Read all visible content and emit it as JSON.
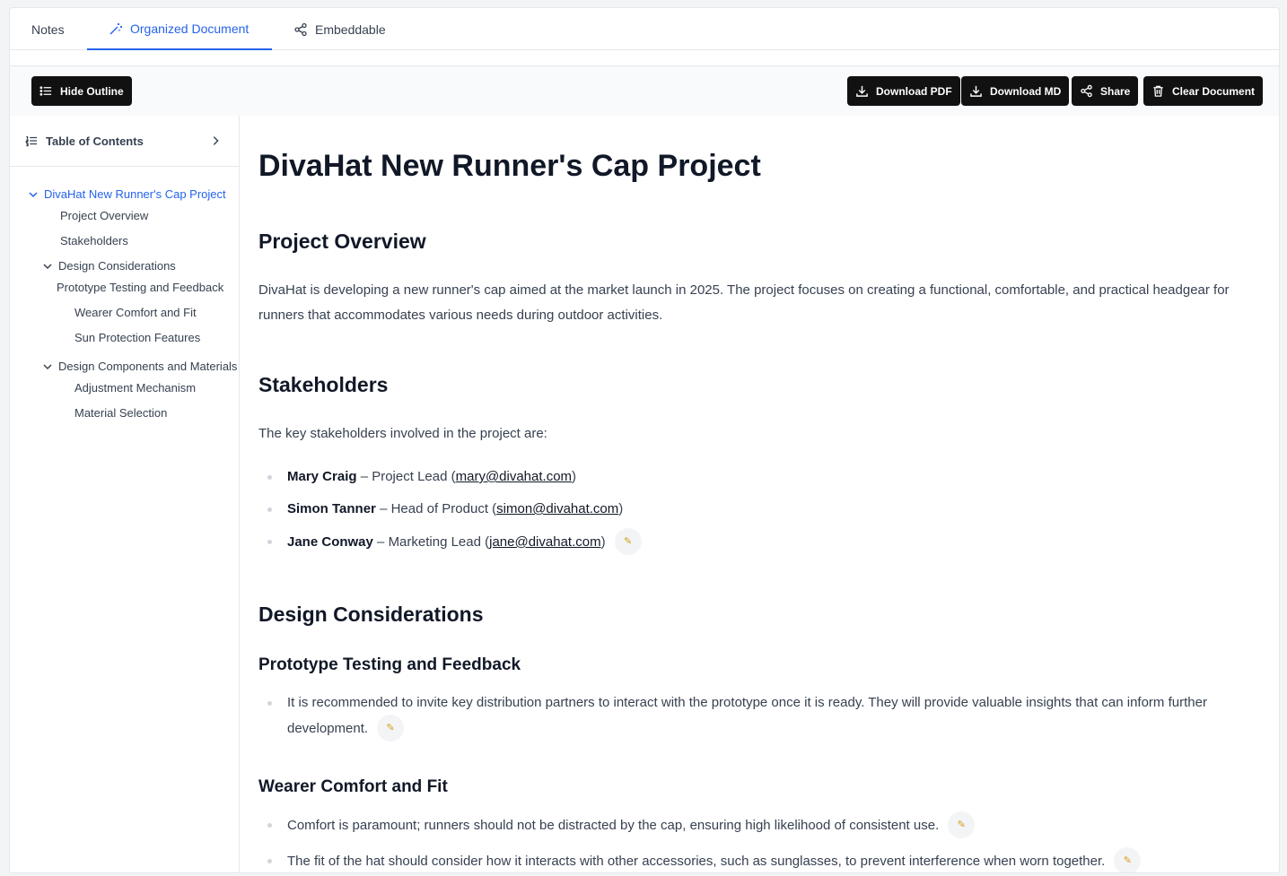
{
  "tabs": [
    {
      "label": "Notes",
      "icon": "none"
    },
    {
      "label": "Organized Document",
      "icon": "magic-wand-icon",
      "active": true
    },
    {
      "label": "Embeddable",
      "icon": "share-nodes-icon"
    }
  ],
  "toolbar": {
    "hide_outline": "Hide Outline",
    "download_pdf": "Download PDF",
    "download_md": "Download MD",
    "share": "Share",
    "clear_document": "Clear Document"
  },
  "toc": {
    "title": "Table of Contents",
    "items": [
      {
        "label": "DivaHat New Runner's Cap Project"
      },
      {
        "label": "Project Overview"
      },
      {
        "label": "Stakeholders"
      },
      {
        "label": "Design Considerations"
      },
      {
        "label": "Prototype Testing and Feedback"
      },
      {
        "label": "Wearer Comfort and Fit"
      },
      {
        "label": "Sun Protection Features"
      },
      {
        "label": "Design Components and Materials"
      },
      {
        "label": "Adjustment Mechanism"
      },
      {
        "label": "Material Selection"
      }
    ]
  },
  "doc": {
    "title": "DivaHat New Runner's Cap Project",
    "overview_heading": "Project Overview",
    "overview_text": "DivaHat is developing a new runner's cap aimed at the market launch in 2025. The project focuses on creating a functional, comfortable, and practical headgear for runners that accommodates various needs during outdoor activities.",
    "stakeholders_heading": "Stakeholders",
    "stakeholders_intro": "The key stakeholders involved in the project are:",
    "stakeholders": [
      {
        "name": "Mary Craig",
        "sep": " – ",
        "role": "Project Lead (",
        "email": "mary@divahat.com",
        "close": ")"
      },
      {
        "name": "Simon Tanner",
        "sep": " – ",
        "role": "Head of Product (",
        "email": "simon@divahat.com",
        "close": ")"
      },
      {
        "name": "Jane Conway",
        "sep": " – ",
        "role": "Marketing Lead (",
        "email": "jane@divahat.com",
        "close": ")"
      }
    ],
    "design_heading": "Design Considerations",
    "prototype_heading": "Prototype Testing and Feedback",
    "prototype_text": "It is recommended to invite key distribution partners to interact with the prototype once it is ready. They will provide valuable insights that can inform further development.",
    "comfort_heading": "Wearer Comfort and Fit",
    "comfort_items": [
      "Comfort is paramount; runners should not be distracted by the cap, ensuring high likelihood of consistent use.",
      "The fit of the hat should consider how it interacts with other accessories, such as sunglasses, to prevent interference when worn together."
    ]
  },
  "colors": {
    "accent": "#2563eb",
    "button": "#111111"
  }
}
